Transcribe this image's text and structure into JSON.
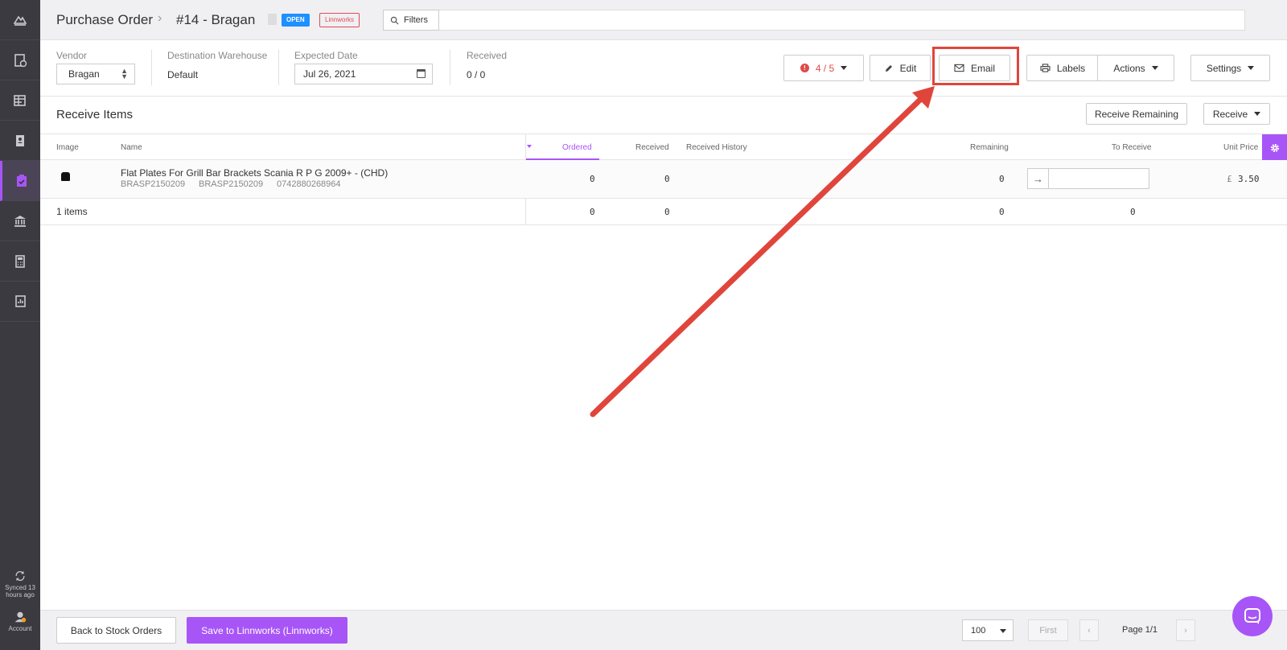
{
  "header": {
    "breadcrumb_root": "Purchase Order",
    "breadcrumb_current": "#14 - Bragan",
    "status_badge": "OPEN",
    "channel_badge": "Linnworks",
    "filters_label": "Filters"
  },
  "info": {
    "vendor_label": "Vendor",
    "vendor_value": "Bragan",
    "warehouse_label": "Destination Warehouse",
    "warehouse_value": "Default",
    "date_label": "Expected Date",
    "date_value": "Jul 26, 2021",
    "received_label": "Received",
    "received_value": "0 / 0"
  },
  "toolbar": {
    "alert_count": "4 / 5",
    "edit_label": "Edit",
    "email_label": "Email",
    "labels_label": "Labels",
    "actions_label": "Actions",
    "settings_label": "Settings"
  },
  "receive": {
    "title": "Receive Items",
    "receive_remaining_label": "Receive Remaining",
    "receive_label": "Receive"
  },
  "table": {
    "columns": {
      "image": "Image",
      "name": "Name",
      "ordered": "Ordered",
      "received": "Received",
      "received_history": "Received History",
      "remaining": "Remaining",
      "to_receive": "To Receive",
      "unit_price": "Unit Price"
    },
    "rows": [
      {
        "name": "Flat Plates For Grill Bar Brackets Scania R P G 2009+ - (CHD)",
        "sku": "BRASP2150209",
        "supplier_code": "BRASP2150209",
        "barcode": "0742880268964",
        "ordered": "0",
        "received": "0",
        "remaining": "0",
        "currency": "£",
        "unit_price": "3.50"
      }
    ],
    "footer": {
      "count_label": "1 items",
      "ordered": "0",
      "received": "0",
      "remaining": "0",
      "to_receive": "0"
    }
  },
  "sidebar": {
    "sync_text": "Synced 13 hours ago",
    "account_label": "Account"
  },
  "bottom": {
    "back_label": "Back to Stock Orders",
    "save_label": "Save to Linnworks (Linnworks)",
    "page_size": "100",
    "first_label": "First",
    "page_text": "Page 1/1"
  },
  "colors": {
    "accent": "#a855f7",
    "annotation": "#e0453c",
    "sidebar_bg": "#3b3a40",
    "open_badge": "#1e90ff"
  }
}
